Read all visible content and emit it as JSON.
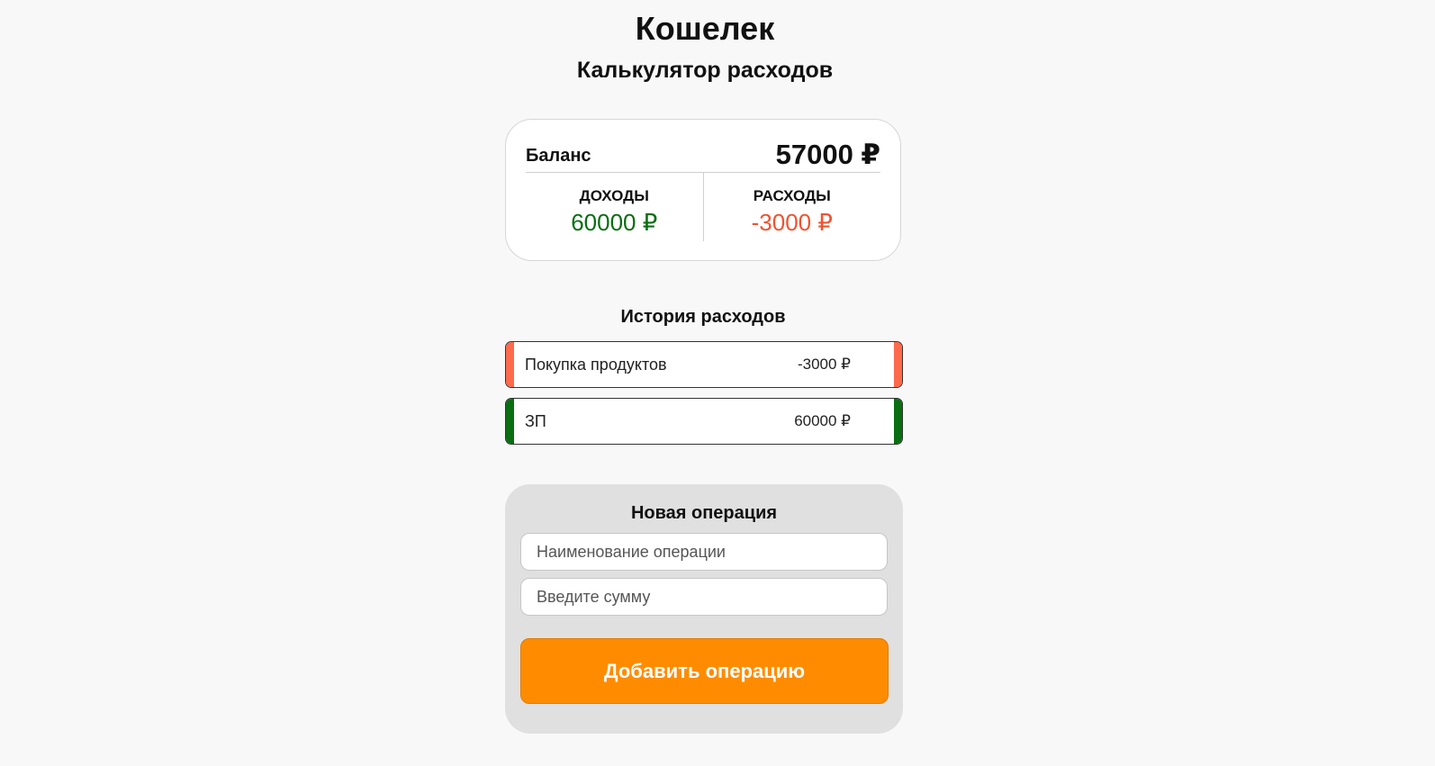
{
  "header": {
    "title": "Кошелек",
    "subtitle": "Калькулятор расходов"
  },
  "balance": {
    "label": "Баланс",
    "value": "57000 ₽",
    "income_label": "ДОХОДЫ",
    "income_value": "60000 ₽",
    "expense_label": "РАСХОДЫ",
    "expense_value": "-3000 ₽"
  },
  "history": {
    "title": "История расходов",
    "items": [
      {
        "name": "Покупка продуктов",
        "amount": "-3000 ₽",
        "type": "expense"
      },
      {
        "name": "ЗП",
        "amount": "60000 ₽",
        "type": "income"
      }
    ]
  },
  "new_operation": {
    "title": "Новая операция",
    "name_placeholder": "Наименование операции",
    "amount_placeholder": "Введите сумму",
    "submit_label": "Добавить операцию"
  },
  "colors": {
    "income": "#0a6e12",
    "expense": "#f0532f",
    "expense_stripe": "#ff6a4d",
    "button": "#ff8c00",
    "background": "#f8f8f8"
  }
}
